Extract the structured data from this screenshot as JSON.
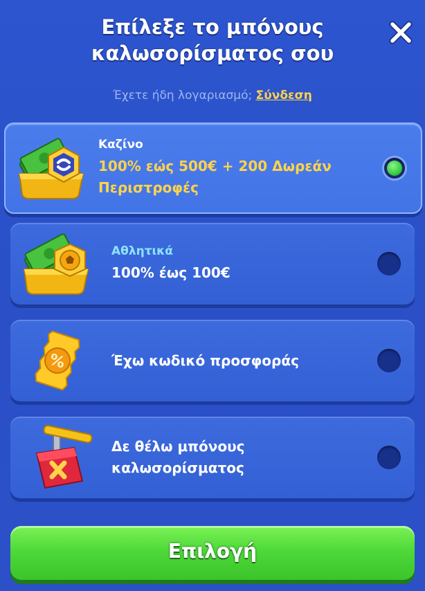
{
  "header": {
    "title_line1": "Επίλεξε το μπόνους",
    "title_line2": "καλωσορίσματος σου",
    "close_icon": "close-icon"
  },
  "login": {
    "prompt": "Έχετε ήδη λογαριασμό;",
    "link_label": "Σύνδεση"
  },
  "options": [
    {
      "sublabel": "Καζίνο",
      "title_line1": "100% εώς 500€ + 200 Δωρεάν",
      "title_line2": "Περιστροφές",
      "icon": "casino-money-chip-icon",
      "selected": true
    },
    {
      "sublabel": "Αθλητικά",
      "title_line1": "100% έως 100€",
      "icon": "sports-money-ball-icon",
      "selected": false
    },
    {
      "title_line1": "Έχω κωδικό προσφοράς",
      "icon": "promo-code-ticket-icon",
      "selected": false
    },
    {
      "title_line1": "Δε θέλω μπόνους",
      "title_line2": "καλωσορίσματος",
      "icon": "no-bonus-detonator-icon",
      "selected": false
    }
  ],
  "cta": {
    "label": "Επιλογή"
  },
  "colors": {
    "background": "#2a4fc8",
    "gold_text": "#ffd34a",
    "sports_label": "#8ee3ff",
    "cta_green": "#4fd93a",
    "selected_radio": "#3dcf46"
  }
}
